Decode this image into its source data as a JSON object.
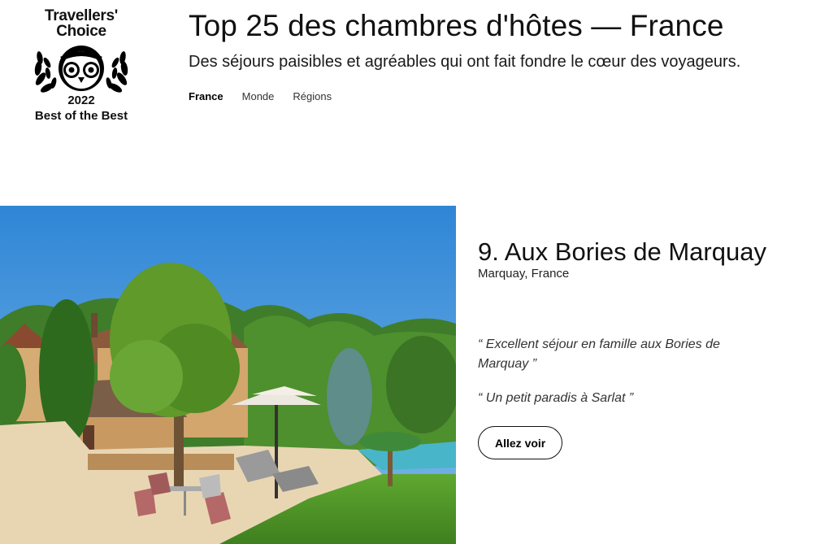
{
  "badge": {
    "line1": "Travellers'",
    "line2": "Choice",
    "year": "2022",
    "tier": "Best of the Best",
    "icon": "owl-laurel-icon"
  },
  "header": {
    "title": "Top 25 des chambres d'hôtes — France",
    "subtitle": "Des séjours paisibles et agréables qui ont fait fondre le cœur des voyageurs.",
    "tabs": [
      {
        "label": "France",
        "active": true
      },
      {
        "label": "Monde",
        "active": false
      },
      {
        "label": "Régions",
        "active": false
      }
    ]
  },
  "listing": {
    "title": "9. Aux Bories de Marquay",
    "location": "Marquay, France",
    "reviews": [
      "“ Excellent séjour en famille aux Bories de Marquay ”",
      "“ Un petit paradis à Sarlat ”"
    ],
    "cta_label": "Allez voir",
    "photo": "garden-pool-house-photo"
  },
  "colors": {
    "text": "#111111",
    "sky": "#3d8fd9",
    "grass": "#4f9a2a",
    "stone": "#c9a06a"
  }
}
